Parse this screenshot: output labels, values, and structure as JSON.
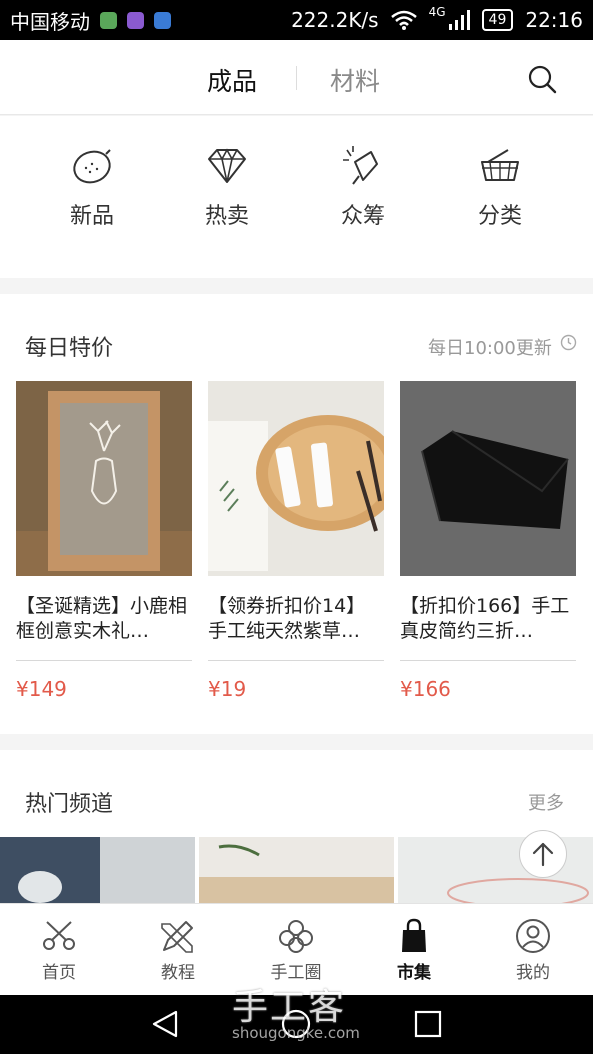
{
  "status_bar": {
    "carrier": "中国移动",
    "network_speed": "222.2K/s",
    "signal": "4G",
    "battery": "49",
    "time": "22:16"
  },
  "top_nav": {
    "tabs": [
      {
        "label": "成品",
        "active": true
      },
      {
        "label": "材料",
        "active": false
      }
    ]
  },
  "categories": [
    {
      "label": "新品",
      "icon": "lemon-icon"
    },
    {
      "label": "热卖",
      "icon": "diamond-icon"
    },
    {
      "label": "众筹",
      "icon": "celebration-icon"
    },
    {
      "label": "分类",
      "icon": "basket-icon"
    }
  ],
  "daily_deals": {
    "title": "每日特价",
    "note": "每日10:00更新",
    "products": [
      {
        "title": "【圣诞精选】小鹿相框创意实木礼…",
        "price": "¥149"
      },
      {
        "title": "【领券折扣价14】手工纯天然紫草…",
        "price": "¥19"
      },
      {
        "title": "【折扣价166】手工真皮简约三折…",
        "price": "¥166"
      }
    ]
  },
  "hot_channels": {
    "title": "热门频道",
    "more": "更多"
  },
  "bottom_nav": {
    "items": [
      {
        "label": "首页",
        "icon": "scissors-icon",
        "active": false
      },
      {
        "label": "教程",
        "icon": "pencil-ruler-icon",
        "active": false
      },
      {
        "label": "手工圈",
        "icon": "flower-icon",
        "active": false
      },
      {
        "label": "市集",
        "icon": "shopping-bag-icon",
        "active": true
      },
      {
        "label": "我的",
        "icon": "user-icon",
        "active": false
      }
    ]
  },
  "watermark": {
    "text": "手工客",
    "sub": "shougongke.com"
  },
  "colors": {
    "price": "#e25a4a",
    "background": "#f4f4f4",
    "active_text": "#111111",
    "inactive_text": "#8a8a8a"
  }
}
